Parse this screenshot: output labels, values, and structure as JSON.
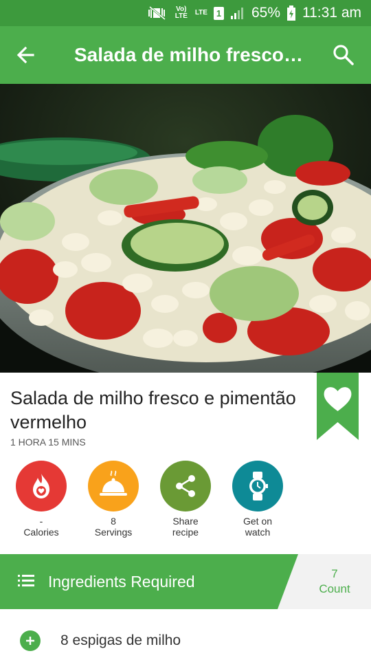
{
  "status_bar": {
    "volte": "Vo) LTE",
    "lte": "LTE",
    "sim": "1",
    "battery": "65%",
    "time": "11:31 am"
  },
  "app_bar": {
    "title": "Salada de milho fresco…",
    "icons": [
      "arrow-back-icon",
      "search-icon"
    ]
  },
  "recipe": {
    "title": "Salada de milho fresco e pimentão vermelho",
    "time": "1 HORA 15 MINS"
  },
  "actions": [
    {
      "icon": "calories-icon",
      "color": "#e53935",
      "line1": "-",
      "line2": "Calories"
    },
    {
      "icon": "servings-icon",
      "color": "#f9a21b",
      "line1": "8",
      "line2": "Servings"
    },
    {
      "icon": "share-icon",
      "color": "#6a9a35",
      "line1": "Share",
      "line2": "recipe"
    },
    {
      "icon": "watch-icon",
      "color": "#0e8a96",
      "line1": "Get on",
      "line2": "watch"
    }
  ],
  "ingredients": {
    "header": "Ingredients Required",
    "count": "7",
    "count_label": "Count",
    "items": [
      "8 espigas de milho"
    ]
  },
  "colors": {
    "primary": "#4cae4c",
    "status_bar": "#3d9a3d",
    "favorite_ribbon": "#4cae4c"
  }
}
